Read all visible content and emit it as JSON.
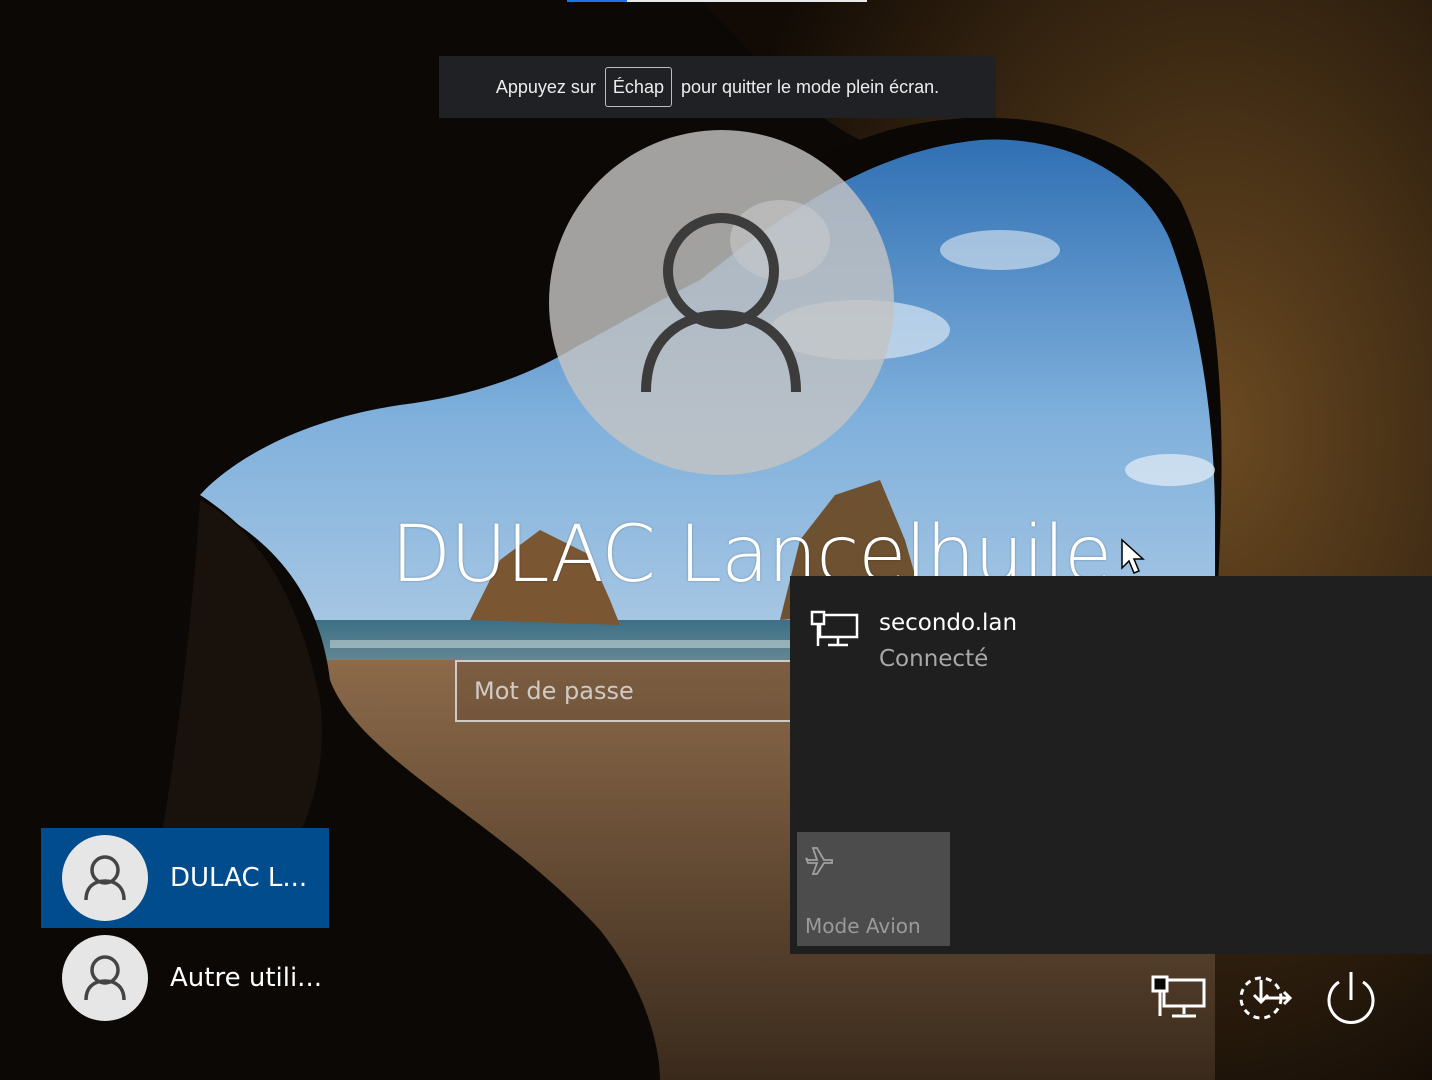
{
  "fullscreen_toast": {
    "prefix": "Appuyez sur",
    "key": "Échap",
    "suffix": "pour quitter le mode plein écran."
  },
  "login": {
    "user_name": "DULAC Lancelhuile",
    "password_placeholder": "Mot de passe"
  },
  "user_list": [
    {
      "label": "DULAC L...",
      "selected": true
    },
    {
      "label": "Autre utili...",
      "selected": false
    }
  ],
  "network_flyout": {
    "network_name": "secondo.lan",
    "network_status": "Connecté",
    "airplane_mode_label": "Mode Avion"
  },
  "bottom_controls": {
    "icons": [
      "network-icon",
      "ease-of-access-icon",
      "power-icon"
    ]
  },
  "colors": {
    "selected_user_bg": "#004c8c",
    "flyout_bg": "#1f1f1f",
    "airplane_tile_bg": "#4c4c4c",
    "toast_bg": "#202124"
  }
}
